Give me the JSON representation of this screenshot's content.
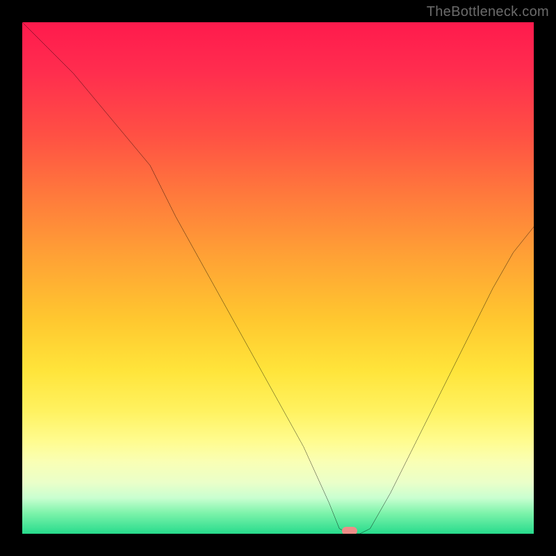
{
  "watermark": "TheBottleneck.com",
  "marker": {
    "x_pct": 64,
    "y_pct": 99.5
  },
  "chart_data": {
    "type": "line",
    "title": "",
    "xlabel": "",
    "ylabel": "",
    "xlim": [
      0,
      100
    ],
    "ylim": [
      0,
      100
    ],
    "grid": false,
    "legend": false,
    "background": {
      "type": "vertical-gradient",
      "note": "color = bottleneck severity; red high, green low",
      "stops": [
        {
          "pct": 0,
          "color": "#ff1a4d"
        },
        {
          "pct": 50,
          "color": "#ffb030"
        },
        {
          "pct": 80,
          "color": "#fff680"
        },
        {
          "pct": 100,
          "color": "#27db8c"
        }
      ]
    },
    "series": [
      {
        "name": "bottleneck-curve",
        "x": [
          0,
          5,
          10,
          15,
          20,
          25,
          30,
          35,
          40,
          45,
          50,
          55,
          60,
          62,
          64,
          66,
          68,
          72,
          76,
          80,
          84,
          88,
          92,
          96,
          100
        ],
        "y": [
          100,
          95,
          90,
          84,
          78,
          72,
          62,
          53,
          44,
          35,
          26,
          17,
          6,
          1,
          0,
          0,
          1,
          8,
          16,
          24,
          32,
          40,
          48,
          55,
          60
        ]
      }
    ],
    "annotations": [
      {
        "type": "point",
        "name": "optimal-marker",
        "x": 64,
        "y": 0,
        "color": "#ed8d88"
      }
    ]
  }
}
